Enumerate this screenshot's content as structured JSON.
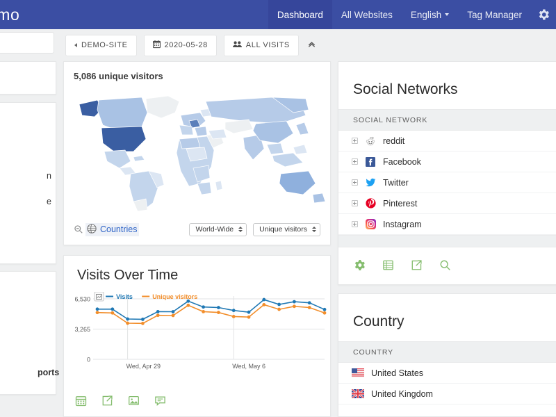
{
  "topnav": {
    "logo": "omo",
    "items": [
      {
        "label": "Dashboard",
        "active": true,
        "caret": false
      },
      {
        "label": "All Websites",
        "active": false,
        "caret": false
      },
      {
        "label": "English",
        "active": false,
        "caret": true
      },
      {
        "label": "Tag Manager",
        "active": false,
        "caret": false
      }
    ],
    "settings_icon": "gear-icon",
    "bg_color": "#3b4ea3",
    "active_bg_color": "#36469b"
  },
  "toolbar": {
    "search_value": "",
    "site_selector": "DEMO-SITE",
    "date_selector": "2020-05-28",
    "segment_selector": "ALL VISITS",
    "collapse_label": "«"
  },
  "sidebar_stub": {
    "fragment_top": "n",
    "fragment_mid": "e",
    "fragment_bottom": "ports"
  },
  "map_widget": {
    "title": "5,086 unique visitors",
    "unique_visitors": "5,086",
    "countries_link": "Countries",
    "search_icon": "magnifier-icon",
    "globe_icon": "globe-icon",
    "region_select": "World-Wide",
    "metric_select": "Unique visitors",
    "legend_low_color": "#eceff1",
    "legend_high_color": "#3a5ea2"
  },
  "visits_widget": {
    "title": "Visits Over Time",
    "footer_icons": [
      "calendar-icon",
      "export-icon",
      "image-icon",
      "annotation-icon"
    ],
    "icon_color": "#85bd6e"
  },
  "chart_data": {
    "type": "line",
    "title": "Visits Over Time",
    "xlabel": "",
    "ylabel": "",
    "ylim": [
      0,
      6530
    ],
    "yticks": [
      0,
      3265,
      6530
    ],
    "ytick_labels": [
      "0",
      "3,265",
      "6,530"
    ],
    "x_tick_labels": [
      "Wed, Apr 29",
      "Wed, May 6"
    ],
    "grid": true,
    "legend_position": "top-left",
    "x": [
      "Mon, Apr 27",
      "Tue, Apr 28",
      "Wed, Apr 29",
      "Thu, Apr 30",
      "Fri, May 1",
      "Sat, May 2",
      "Sun, May 3",
      "Mon, May 4",
      "Tue, May 5",
      "Wed, May 6",
      "Thu, May 7",
      "Fri, May 8",
      "Sat, May 9",
      "Sun, May 10",
      "Mon, May 11",
      "Tue, May 12"
    ],
    "series": [
      {
        "name": "Visits",
        "color": "#1f78b4",
        "values": [
          5420,
          5420,
          4350,
          4320,
          5150,
          5140,
          6280,
          5650,
          5590,
          5280,
          5090,
          6450,
          5930,
          6220,
          6100,
          5380
        ]
      },
      {
        "name": "Unique visitors",
        "color": "#f28e2b",
        "values": [
          5050,
          5010,
          3900,
          3880,
          4750,
          4730,
          5830,
          5150,
          5060,
          4620,
          4560,
          5900,
          5400,
          5720,
          5590,
          5010
        ]
      }
    ]
  },
  "social_widget": {
    "title": "Social Networks",
    "column_header": "SOCIAL NETWORK",
    "rows": [
      {
        "label": "reddit",
        "icon": "reddit-icon"
      },
      {
        "label": "Facebook",
        "icon": "facebook-icon"
      },
      {
        "label": "Twitter",
        "icon": "twitter-icon"
      },
      {
        "label": "Pinterest",
        "icon": "pinterest-icon"
      },
      {
        "label": "Instagram",
        "icon": "instagram-icon"
      }
    ],
    "footer_icons": [
      "gear-icon",
      "table-icon",
      "export-icon",
      "search-icon"
    ],
    "icon_color": "#85bd6e"
  },
  "country_widget": {
    "title": "Country",
    "column_header": "COUNTRY",
    "rows": [
      {
        "label": "United States",
        "icon": "flag-us-icon"
      },
      {
        "label": "United Kingdom",
        "icon": "flag-gb-icon"
      }
    ]
  }
}
